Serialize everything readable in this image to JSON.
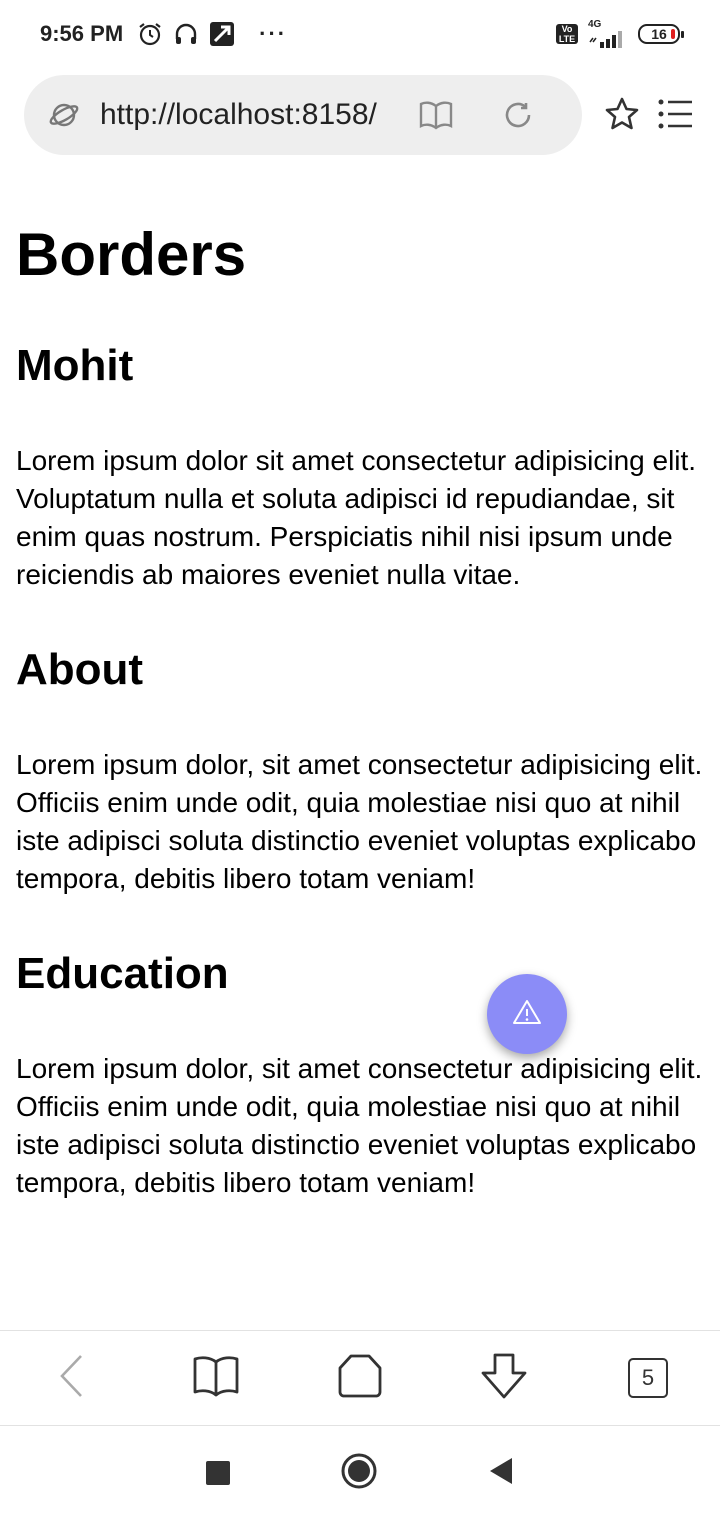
{
  "status_bar": {
    "time": "9:56 PM",
    "icons": [
      "alarm-icon",
      "headphones-icon",
      "app-icon",
      "more-dots-icon"
    ],
    "overflow": "···",
    "volte": [
      "Vo",
      "LTE"
    ],
    "network": "4G",
    "battery": "16"
  },
  "browser": {
    "url": "http://localhost:8158/",
    "icons": [
      "site-icon",
      "reader-mode-icon",
      "reload-icon",
      "bookmark-star-icon",
      "menu-icon"
    ]
  },
  "page": {
    "title": "Borders",
    "sections": [
      {
        "heading": "Mohit",
        "text": "Lorem ipsum dolor sit amet consectetur adipisicing elit. Voluptatum nulla et soluta adipisci id repudiandae, sit enim quas nostrum. Perspiciatis nihil nisi ipsum unde reiciendis ab maiores eveniet nulla vitae."
      },
      {
        "heading": "About",
        "text": "Lorem ipsum dolor, sit amet consectetur adipisicing elit. Officiis enim unde odit, quia molestiae nisi quo at nihil iste adipisci soluta distinctio eveniet voluptas explicabo tempora, debitis libero totam veniam!"
      },
      {
        "heading": "Education",
        "text": "Lorem ipsum dolor, sit amet consectetur adipisicing elit. Officiis enim unde odit, quia molestiae nisi quo at nihil iste adipisci soluta distinctio eveniet voluptas explicabo tempora, debitis libero totam veniam!"
      }
    ]
  },
  "fab": {
    "icon": "warning-icon",
    "color": "#8b8cf7"
  },
  "bottom_toolbar": {
    "items": [
      "back-icon",
      "bookmarks-icon",
      "home-icon",
      "download-icon",
      "tabs-icon"
    ],
    "tab_count": "5"
  },
  "nav_bar": {
    "items": [
      "recents-icon",
      "home-icon",
      "back-icon"
    ]
  }
}
